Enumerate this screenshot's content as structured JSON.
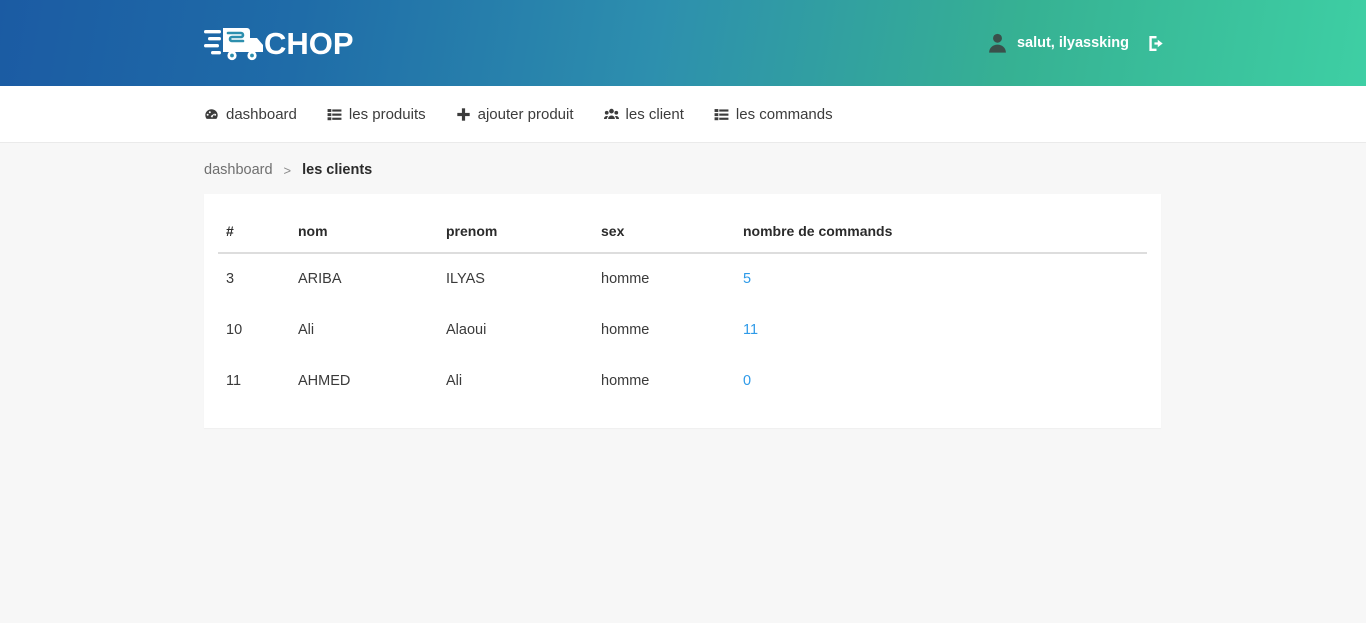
{
  "header": {
    "brand_name": "CHOP",
    "brand_icon": "fast-delivery-truck-icon",
    "user_icon": "user-avatar-icon",
    "greeting": "salut, ilyassking",
    "logout_icon": "sign-out-icon",
    "gradient_start": "#1b5ba3",
    "gradient_end": "#3ecfa4"
  },
  "nav": {
    "items": [
      {
        "label": "dashboard",
        "icon": "tachometer-icon"
      },
      {
        "label": "les produits",
        "icon": "list-icon"
      },
      {
        "label": "ajouter produit",
        "icon": "plus-icon"
      },
      {
        "label": "les client",
        "icon": "users-icon"
      },
      {
        "label": "les commands",
        "icon": "list-icon"
      }
    ]
  },
  "breadcrumb": {
    "root": "dashboard",
    "separator": ">",
    "current": "les clients"
  },
  "table": {
    "columns": [
      "#",
      "nom",
      "prenom",
      "sex",
      "nombre de commands"
    ],
    "rows": [
      {
        "id": "3",
        "nom": "ARIBA",
        "prenom": "ILYAS",
        "sex": "homme",
        "commandes": "5"
      },
      {
        "id": "10",
        "nom": "Ali",
        "prenom": "Alaoui",
        "sex": "homme",
        "commandes": "11"
      },
      {
        "id": "11",
        "nom": "AHMED",
        "prenom": "Ali",
        "sex": "homme",
        "commandes": "0"
      }
    ],
    "link_color": "#2e9ae8"
  },
  "page": {
    "background": "#f7f7f7",
    "card_background": "#ffffff"
  }
}
